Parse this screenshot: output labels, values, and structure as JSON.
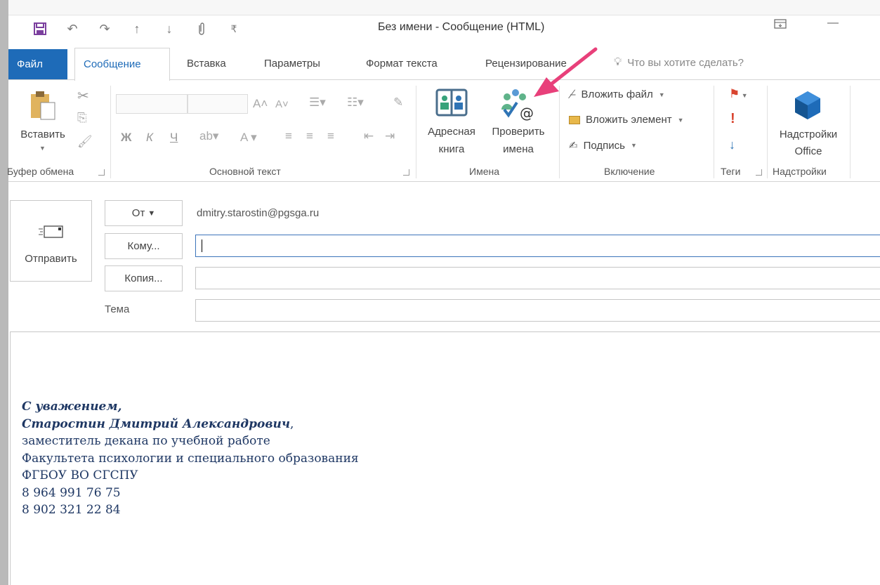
{
  "window": {
    "title": "Без имени  -  Сообщение (HTML)"
  },
  "tabs": {
    "file": "Файл",
    "message": "Сообщение",
    "insert": "Вставка",
    "options": "Параметры",
    "format_text": "Формат текста",
    "review": "Рецензирование",
    "tell_me_placeholder": "Что вы хотите сделать?"
  },
  "ribbon": {
    "clipboard": {
      "paste_label": "Вставить",
      "group_label": "Буфер обмена"
    },
    "basic_text": {
      "group_label": "Основной текст",
      "bold": "Ж",
      "italic": "К",
      "underline": "Ч"
    },
    "names": {
      "address_book_line1": "Адресная",
      "address_book_line2": "книга",
      "check_names_line1": "Проверить",
      "check_names_line2": "имена",
      "group_label": "Имена"
    },
    "include": {
      "attach_file": "Вложить файл",
      "attach_item": "Вложить элемент",
      "signature": "Подпись",
      "group_label": "Включение"
    },
    "tags": {
      "group_label": "Теги"
    },
    "addins": {
      "office_addins_line1": "Надстройки",
      "office_addins_line2": "Office",
      "group_label": "Надстройки"
    }
  },
  "compose": {
    "send_label": "Отправить",
    "from_button": "От",
    "from_value": "dmitry.starostin@pgsga.ru",
    "to_button": "Кому...",
    "cc_button": "Копия...",
    "subject_label": "Тема",
    "to_value": "",
    "cc_value": "",
    "subject_value": ""
  },
  "signature": {
    "line1": "С уважением,",
    "line2": "Старостин Дмитрий Александрович",
    "line2_suffix": ",",
    "line3": "заместитель декана по учебной работе",
    "line4": "Факультета психологии и специального образования",
    "line5": "ФГБОУ ВО СГСПУ",
    "line6": "8 964 991 76 75",
    "line7": "8 902 321 22 84"
  },
  "colors": {
    "accent": "#1e6bb8",
    "annotation_arrow": "#e8407a",
    "signature_text": "#1f3864"
  }
}
